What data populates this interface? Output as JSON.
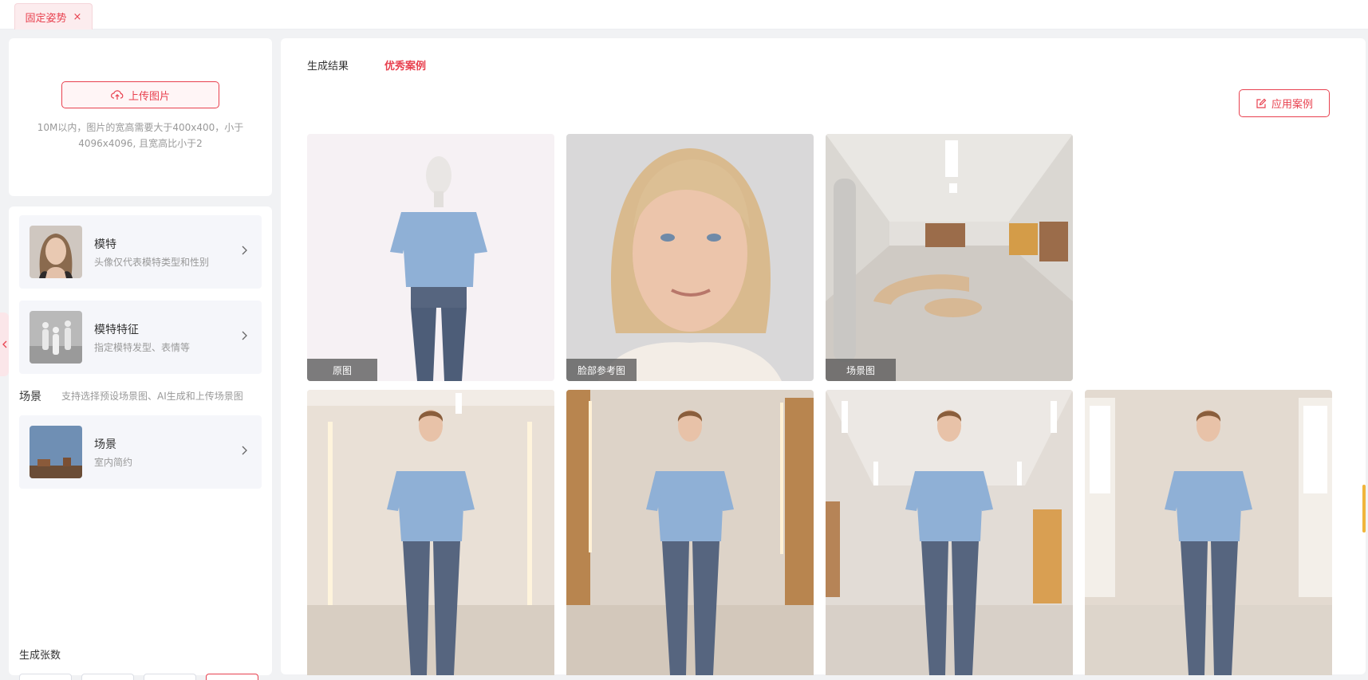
{
  "tabs": [
    {
      "label": "固定姿势",
      "close": "×"
    }
  ],
  "upload": {
    "button_label": "上传图片",
    "hint": "10M以内，图片的宽高需要大于400x400，小于4096x4096, 且宽高比小于2"
  },
  "options": {
    "model": {
      "title": "模特",
      "subtitle": "头像仅代表模特类型和性别"
    },
    "model_features": {
      "title": "模特特征",
      "subtitle": "指定模特发型、表情等"
    },
    "scene_section": {
      "label": "场景",
      "hint": "支持选择预设场景图、AI生成和上传场景图"
    },
    "scene": {
      "title": "场景",
      "subtitle": "室内简约"
    },
    "count_label": "生成张数"
  },
  "main": {
    "tabs": [
      {
        "label": "生成结果",
        "active": false
      },
      {
        "label": "优秀案例",
        "active": true
      }
    ],
    "apply_button": "应用案例",
    "reference_images": [
      {
        "label": "原图"
      },
      {
        "label": "脸部参考图"
      },
      {
        "label": "场景图"
      }
    ]
  },
  "colors": {
    "accent": "#e8414f",
    "accent_bg": "#fff5f6",
    "panel": "#ffffff",
    "page": "#f1f2f4"
  }
}
